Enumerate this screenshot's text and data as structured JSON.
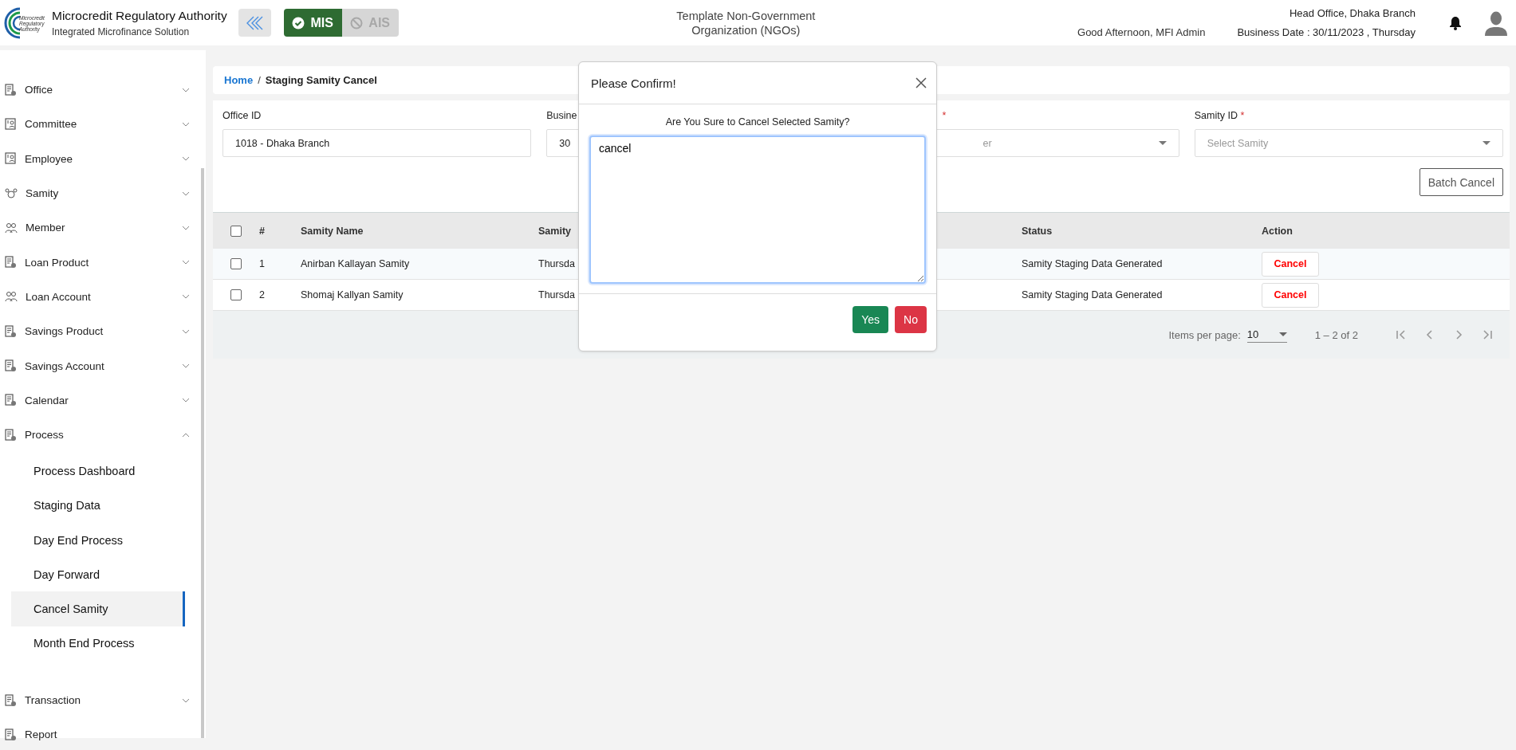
{
  "header": {
    "org_name": "Microcredit Regulatory Authority",
    "subtitle": "Integrated Microfinance Solution",
    "logo_text": [
      "Microcredit",
      "Regulatory",
      "Authority"
    ],
    "modules": [
      {
        "label": "MIS",
        "selected": true
      },
      {
        "label": "AIS",
        "selected": false
      }
    ],
    "center_title": [
      "Template Non-Government",
      "Organization (NGOs)"
    ],
    "greeting": "Good Afternoon, MFI Admin",
    "office": "Head Office, Dhaka Branch",
    "business_date": "Business Date : 30/11/2023 , Thursday"
  },
  "sidebar": {
    "items": [
      {
        "label": "Office",
        "kind": "group",
        "expanded": false
      },
      {
        "label": "Committee",
        "kind": "group",
        "expanded": false
      },
      {
        "label": "Employee",
        "kind": "group",
        "expanded": false
      },
      {
        "label": "Samity",
        "kind": "group",
        "expanded": false
      },
      {
        "label": "Member",
        "kind": "group",
        "expanded": false
      },
      {
        "label": "Loan Product",
        "kind": "group",
        "expanded": false
      },
      {
        "label": "Loan Account",
        "kind": "group",
        "expanded": false
      },
      {
        "label": "Savings Product",
        "kind": "group",
        "expanded": false
      },
      {
        "label": "Savings Account",
        "kind": "group",
        "expanded": false
      },
      {
        "label": "Calendar",
        "kind": "group",
        "expanded": false
      },
      {
        "label": "Process",
        "kind": "group",
        "expanded": true,
        "children": [
          {
            "label": "Process Dashboard",
            "selected": false
          },
          {
            "label": "Staging Data",
            "selected": false
          },
          {
            "label": "Day End Process",
            "selected": false
          },
          {
            "label": "Day Forward",
            "selected": false
          },
          {
            "label": "Cancel Samity",
            "selected": true
          },
          {
            "label": "Month End Process",
            "selected": false
          }
        ]
      },
      {
        "label": "Transaction",
        "kind": "group",
        "expanded": false
      },
      {
        "label": "Report",
        "kind": "link"
      }
    ]
  },
  "breadcrumb": {
    "home": "Home",
    "separator": "/",
    "current": "Staging Samity Cancel"
  },
  "required_mark": "*",
  "filters": [
    {
      "label": "Office ID",
      "kind": "text",
      "value": "1018 - Dhaka Branch"
    },
    {
      "label": "Busine",
      "kind": "text",
      "value": "30"
    },
    {
      "required": true,
      "kind": "select",
      "placeholder": "er"
    },
    {
      "label": "Samity ID",
      "required": true,
      "kind": "select",
      "placeholder": "Select Samity"
    }
  ],
  "batch_button": "Batch Cancel",
  "table": {
    "header_checked": false,
    "columns": [
      "#",
      "Samity Name",
      "Samity",
      "Status",
      "Action"
    ],
    "rows": [
      {
        "checked": false,
        "number": "1",
        "name": "Anirban Kallayan Samity",
        "day": "Thursda",
        "status": "Samity Staging Data Generated",
        "action": "Cancel"
      },
      {
        "checked": false,
        "number": "2",
        "name": "Shomaj Kallyan Samity",
        "day": "Thursda",
        "status": "Samity Staging Data Generated",
        "action": "Cancel"
      }
    ]
  },
  "pagination": {
    "items_label": "Items per page:",
    "page_size": "10",
    "range": "1 – 2 of 2",
    "disabled": true
  },
  "modal": {
    "title": "Please Confirm!",
    "message": "Are You Sure to Cancel Selected Samity?",
    "reason": "cancel",
    "yes": "Yes",
    "no": "No"
  }
}
